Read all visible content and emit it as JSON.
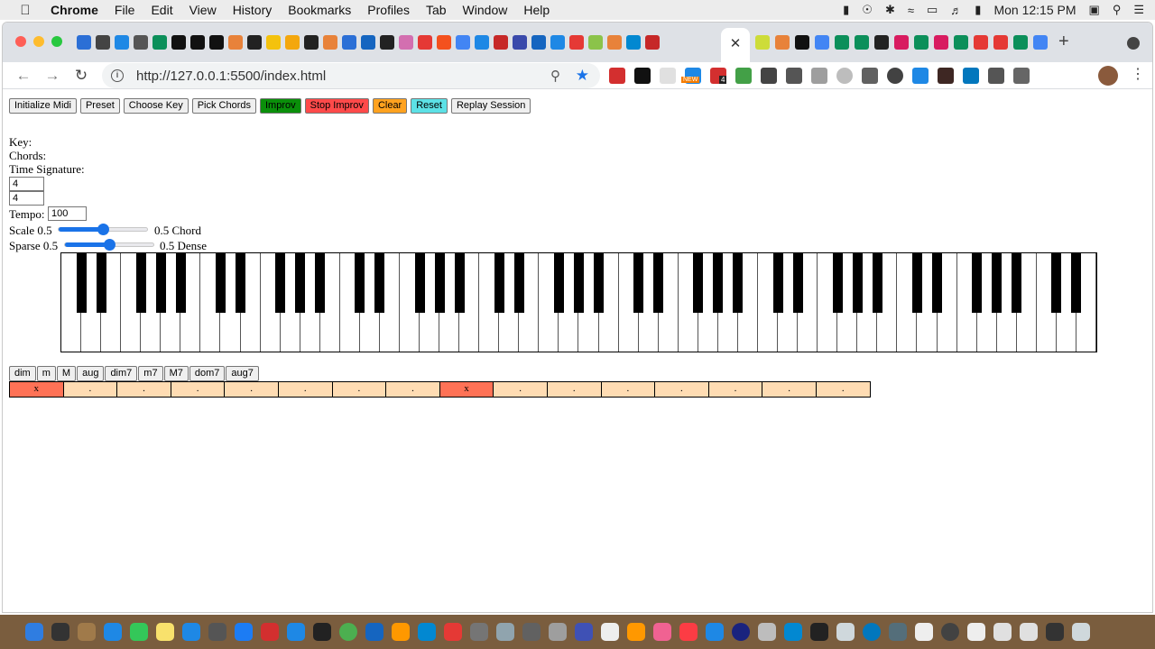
{
  "menubar": {
    "app_name": "Chrome",
    "items": [
      "File",
      "Edit",
      "View",
      "History",
      "Bookmarks",
      "Profiles",
      "Tab",
      "Window",
      "Help"
    ],
    "clock": "Mon 12:15 PM"
  },
  "browser": {
    "url": "127.0.0.1:5500/index.html",
    "url_scheme": "http://",
    "new_badge": "NEW",
    "ext_count": "4"
  },
  "app": {
    "buttons": {
      "init_midi": "Initialize Midi",
      "preset": "Preset",
      "choose_key": "Choose Key",
      "pick_chords": "Pick Chords",
      "improv": "Improv",
      "stop_improv": "Stop Improv",
      "clear": "Clear",
      "reset": "Reset",
      "replay": "Replay Session"
    },
    "labels": {
      "key": "Key:",
      "chords": "Chords:",
      "time_signature": "Time Signature:",
      "tempo": "Tempo:",
      "scale_left": "Scale 0.5",
      "scale_right": "0.5 Chord",
      "sparse_left": "Sparse 0.5",
      "sparse_right": "0.5 Dense"
    },
    "time_signature": {
      "numerator": "4",
      "denominator": "4"
    },
    "tempo": "100",
    "scale_slider_value": 0.5,
    "sparse_slider_value": 0.5,
    "chord_types": [
      "dim",
      "m",
      "M",
      "aug",
      "dim7",
      "m7",
      "M7",
      "dom7",
      "aug7"
    ],
    "grid_cells": [
      "x",
      ".",
      ".",
      ".",
      ".",
      ".",
      ".",
      ".",
      "x",
      ".",
      ".",
      ".",
      ".",
      ".",
      ".",
      "."
    ],
    "colors": {
      "improv": "#0a8f0a",
      "stop_improv": "#ff4a4a",
      "clear": "#ffa21f",
      "reset": "#5ce1e6",
      "grid_cell": "#ffdcb3",
      "grid_active": "#ff7256"
    }
  }
}
